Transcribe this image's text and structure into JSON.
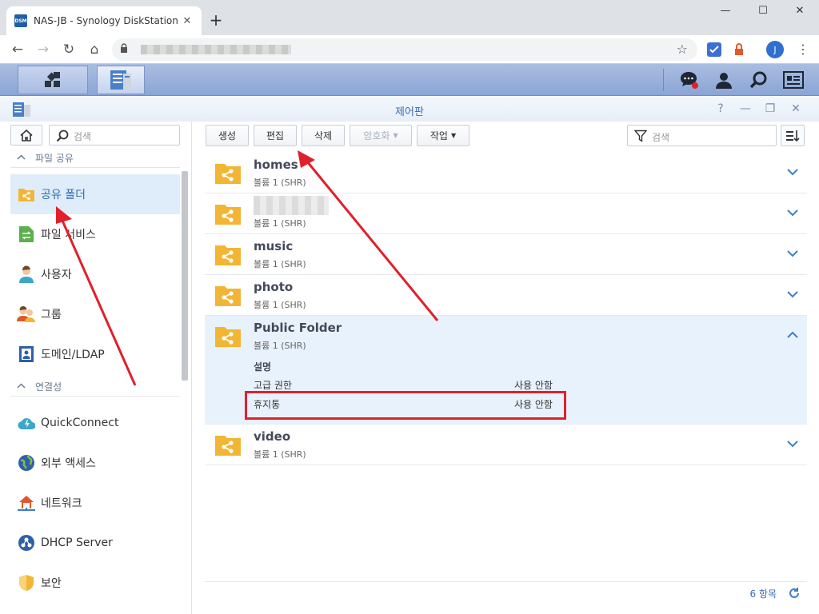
{
  "browser": {
    "tab_title": "NAS-JB - Synology DiskStation",
    "favicon_text": "DSM",
    "close_glyph": "✕",
    "new_tab_glyph": "+",
    "minimize_glyph": "—",
    "maximize_glyph": "☐",
    "window_close_glyph": "✕",
    "back_glyph": "←",
    "forward_glyph": "→",
    "reload_glyph": "↻",
    "home_glyph": "⌂",
    "star_glyph": "☆",
    "avatar_initial": "J",
    "menu_glyph": "⋮"
  },
  "window": {
    "title": "제어판",
    "help_glyph": "?",
    "minimize_glyph": "—",
    "restore_glyph": "❐",
    "close_glyph": "✕"
  },
  "sidebar": {
    "search_placeholder": "검색",
    "sections": [
      {
        "label": "파일 공유",
        "caret": "^"
      },
      {
        "label": "연결성",
        "caret": "^"
      }
    ],
    "items": [
      {
        "label": "공유 폴더",
        "icon": "shared-folder-icon"
      },
      {
        "label": "파일 서비스",
        "icon": "file-services-icon"
      },
      {
        "label": "사용자",
        "icon": "user-icon"
      },
      {
        "label": "그룹",
        "icon": "group-icon"
      },
      {
        "label": "도메인/LDAP",
        "icon": "domain-ldap-icon"
      },
      {
        "label": "QuickConnect",
        "icon": "quickconnect-icon"
      },
      {
        "label": "외부 액세스",
        "icon": "external-access-icon"
      },
      {
        "label": "네트워크",
        "icon": "network-icon"
      },
      {
        "label": "DHCP Server",
        "icon": "dhcp-server-icon"
      },
      {
        "label": "보안",
        "icon": "security-icon"
      }
    ]
  },
  "toolbar": {
    "create": "생성",
    "edit": "편집",
    "delete": "삭제",
    "encryption": "암호화",
    "action": "작업",
    "dropdown_glyph": "▼",
    "search_placeholder": "검색"
  },
  "folders": [
    {
      "name": "homes",
      "volume": "볼륨 1 (SHR)"
    },
    {
      "name": "",
      "volume": "볼륨 1 (SHR)"
    },
    {
      "name": "music",
      "volume": "볼륨 1 (SHR)"
    },
    {
      "name": "photo",
      "volume": "볼륨 1 (SHR)"
    },
    {
      "name": "Public Folder",
      "volume": "볼륨 1 (SHR)",
      "details": {
        "title": "설명",
        "rows": [
          {
            "key": "고급 권한",
            "value": "사용 안함"
          },
          {
            "key": "휴지통",
            "value": "사용 안함"
          }
        ]
      }
    },
    {
      "name": "video",
      "volume": "볼륨 1 (SHR)"
    }
  ],
  "footer": {
    "count": "6 항목"
  },
  "colors": {
    "accent": "#3a6ab3",
    "folder": "#f2b534",
    "annotation": "#e0202c",
    "selection": "#dfecfa"
  }
}
